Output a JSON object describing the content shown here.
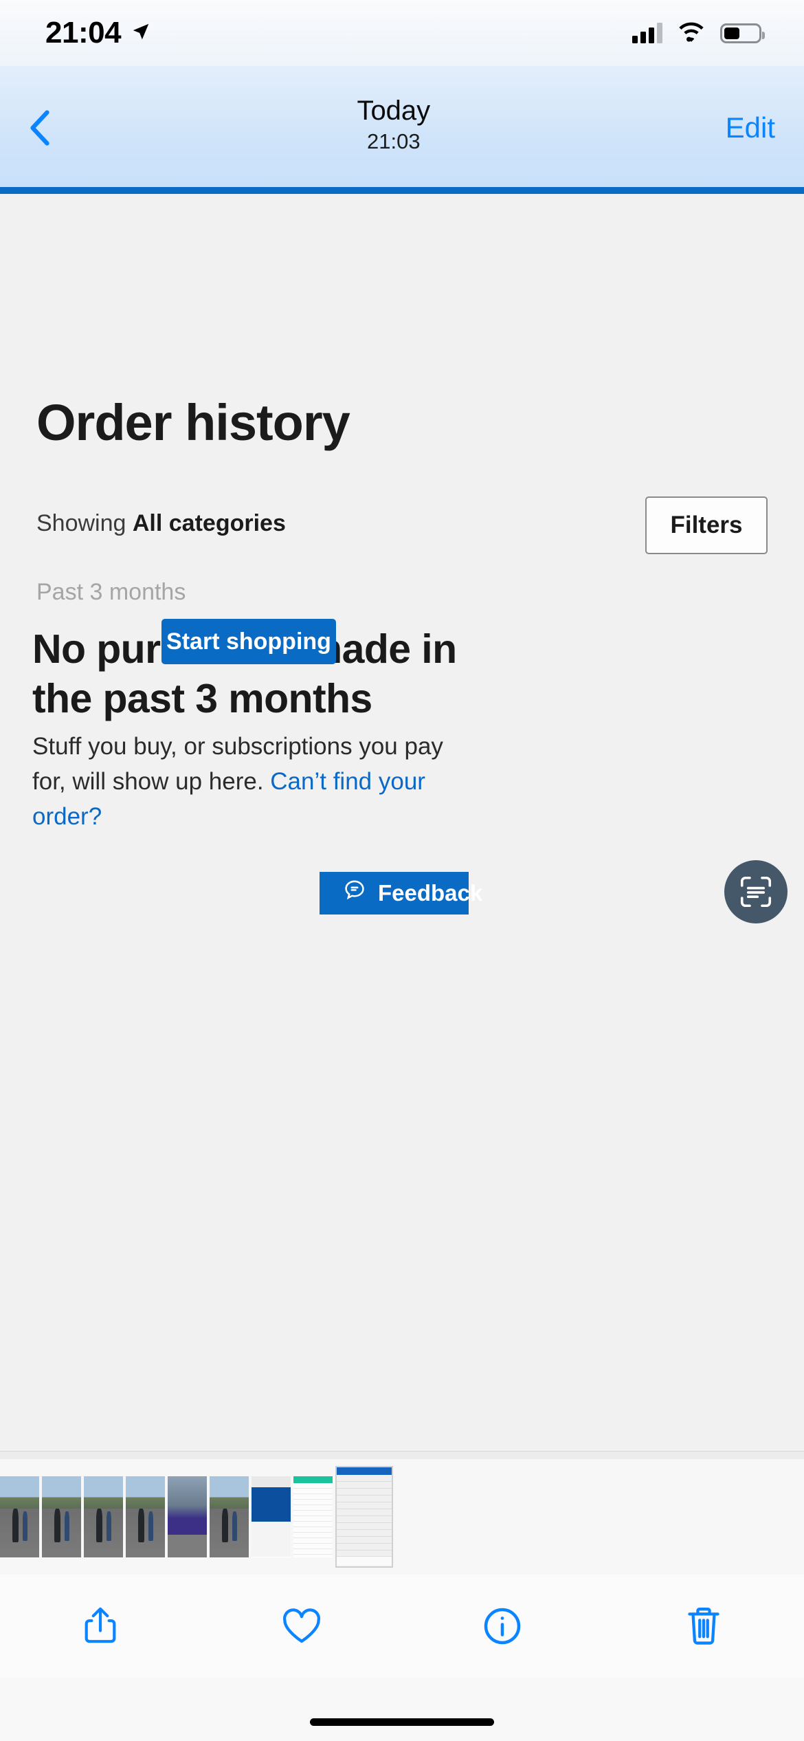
{
  "status_bar": {
    "time": "21:04",
    "location_icon": "location-arrow-icon",
    "signal_icon": "cellular-signal-icon",
    "wifi_icon": "wifi-icon",
    "battery_icon": "battery-icon",
    "battery_level_pct": 45
  },
  "nav_bar": {
    "back_label": "back-chevron",
    "title": "Today",
    "subtitle": "21:03",
    "edit_label": "Edit"
  },
  "page": {
    "title": "Order history",
    "showing_prefix": "Showing ",
    "showing_value": "All categories",
    "filters_label": "Filters",
    "range_label": "Past 3 months",
    "empty_heading": "No purchases made in the past 3 months",
    "empty_body_text": "Stuff you buy, or subscriptions you pay for, will show up here. ",
    "empty_body_link": "Can’t find your order?",
    "start_shopping_label": "Start shopping",
    "feedback_label": "Feedback",
    "scan_text_icon": "scan-text-icon"
  },
  "colors": {
    "accent_blue": "#0a6bc4",
    "link_blue": "#0a69c7",
    "ios_blue": "#0a84ff",
    "page_bg": "#f1f1f1",
    "fab_bg": "#44586a"
  },
  "thumbnails": [
    {
      "name": "runner-photo-1",
      "kind": "t-run",
      "selected": false
    },
    {
      "name": "runner-photo-2",
      "kind": "t-run",
      "selected": false
    },
    {
      "name": "runner-photo-3",
      "kind": "t-run",
      "selected": false
    },
    {
      "name": "runner-photo-4",
      "kind": "t-run",
      "selected": false
    },
    {
      "name": "race-banner-photo",
      "kind": "t-banner",
      "selected": false
    },
    {
      "name": "runner-photo-5",
      "kind": "t-run",
      "selected": false
    },
    {
      "name": "savings-screenshot",
      "kind": "t-app1",
      "selected": false
    },
    {
      "name": "journey-screenshot",
      "kind": "t-app2",
      "selected": false
    },
    {
      "name": "order-history-screenshot",
      "kind": "t-app3",
      "selected": true
    }
  ],
  "toolbar": {
    "items": [
      {
        "name": "share-icon",
        "label": "Share"
      },
      {
        "name": "heart-icon",
        "label": "Favourite"
      },
      {
        "name": "info-icon",
        "label": "Info"
      },
      {
        "name": "trash-icon",
        "label": "Delete"
      }
    ]
  }
}
